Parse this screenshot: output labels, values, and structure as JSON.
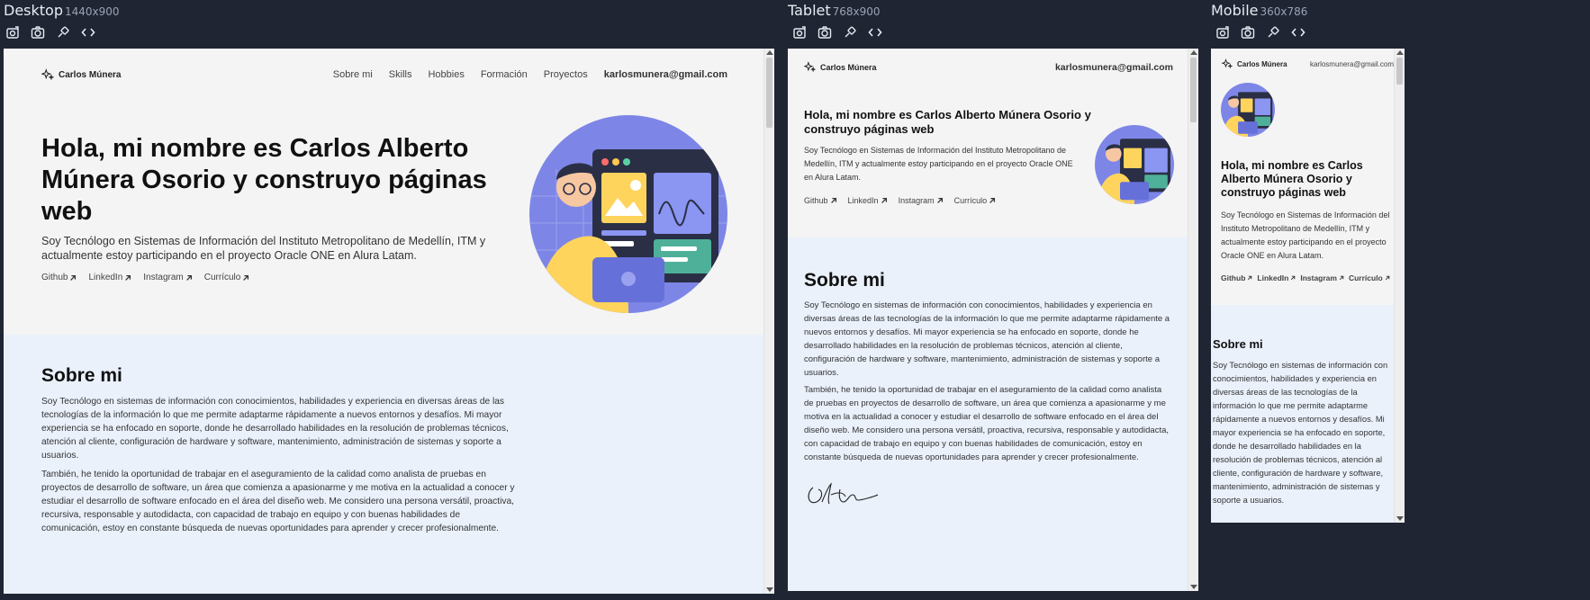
{
  "devices": {
    "desktop": {
      "name": "Desktop",
      "dims": "1440x900"
    },
    "tablet": {
      "name": "Tablet",
      "dims": "768x900"
    },
    "mobile": {
      "name": "Mobile",
      "dims": "360x786"
    }
  },
  "site": {
    "logo": "Carlos Múnera",
    "nav": [
      "Sobre mi",
      "Skills",
      "Hobbies",
      "Formación",
      "Proyectos"
    ],
    "email": "karlosmunera@gmail.com",
    "hero_title": "Hola, mi nombre es Carlos Alberto Múnera Osorio y construyo páginas web",
    "hero_text": "Soy Tecnólogo en Sistemas de Información del Instituto Metropolitano de Medellín, ITM y actualmente estoy participando en el proyecto Oracle ONE en Alura Latam.",
    "social": [
      "Github",
      "LinkedIn",
      "Instagram",
      "Currículo"
    ],
    "sobre_title": "Sobre mi",
    "sobre_p1": "Soy Tecnólogo en sistemas de información con conocimientos, habilidades y experiencia en diversas áreas de las tecnologías de la información lo que me permite adaptarme rápidamente a nuevos entornos y desafíos. Mi mayor experiencia se ha enfocado en soporte, donde he desarrollado habilidades en la resolución de problemas técnicos, atención al cliente, configuración de hardware y software, mantenimiento, administración de sistemas y soporte a usuarios.",
    "sobre_p2": "También, he tenido la oportunidad de trabajar en el aseguramiento de la calidad como analista de pruebas en proyectos de desarrollo de software, un área que comienza a apasionarme y me motiva en la actualidad a conocer y estudiar el desarrollo de software enfocado en el área del diseño web. Me considero una persona versátil, proactiva, recursiva, responsable y autodidacta, con capacidad de trabajo en equipo y con buenas habilidades de comunicación, estoy en constante búsqueda de nuevas oportunidades para aprender y crecer profesionalmente."
  },
  "colors": {
    "background": "#1f2533",
    "page": "#f4f4f4",
    "section": "#eaf1fb",
    "illustration": "#7d86e6"
  }
}
